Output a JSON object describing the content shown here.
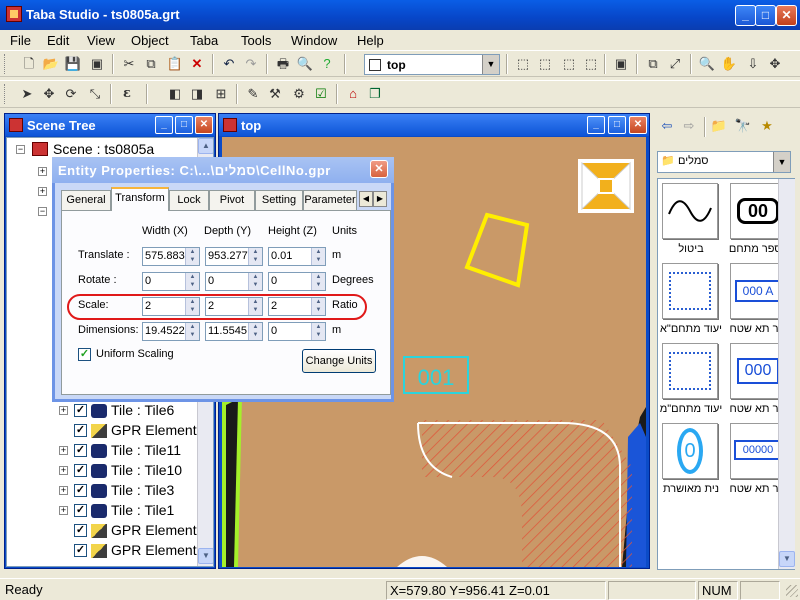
{
  "window": {
    "title": "Taba Studio - ts0805a.grt"
  },
  "menu": [
    "File",
    "Edit",
    "View",
    "Object",
    "Taba",
    "Tools",
    "Window",
    "Help"
  ],
  "toolbar": {
    "view_select": "top",
    "taba_button": "ε"
  },
  "scene_tree": {
    "title": "Scene Tree",
    "root": "Scene : ts0805a",
    "items": [
      {
        "label": "Tile : Tile6",
        "type": "tile"
      },
      {
        "label": "GPR Element",
        "type": "gpr"
      },
      {
        "label": "Tile : Tile11",
        "type": "tile"
      },
      {
        "label": "Tile : Tile10",
        "type": "tile"
      },
      {
        "label": "Tile : Tile3",
        "type": "tile"
      },
      {
        "label": "Tile : Tile1",
        "type": "tile"
      },
      {
        "label": "GPR Element",
        "type": "gpr"
      },
      {
        "label": "GPR Element",
        "type": "gpr"
      }
    ]
  },
  "view_window": {
    "title": "top",
    "cell_label": "001"
  },
  "dialog": {
    "title": "Entity Properties: C:\\...\\סמלים\\CellNo.gpr",
    "tabs": [
      "General",
      "Transform",
      "Lock",
      "Pivot",
      "Setting",
      "Parameter"
    ],
    "active_tab": "Transform",
    "headers": {
      "width": "Width (X)",
      "depth": "Depth (Y)",
      "height": "Height (Z)",
      "units": "Units"
    },
    "rows": [
      {
        "label": "Translate :",
        "x": "575.883",
        "y": "953.277",
        "z": "0.01",
        "unit": "m"
      },
      {
        "label": "Rotate :",
        "x": "0",
        "y": "0",
        "z": "0",
        "unit": "Degrees"
      },
      {
        "label": "Scale:",
        "x": "2",
        "y": "2",
        "z": "2",
        "unit": "Ratio"
      },
      {
        "label": "Dimensions:",
        "x": "19.4522",
        "y": "11.5545",
        "z": "0",
        "unit": "m"
      }
    ],
    "uniform_scaling": {
      "label": "Uniform Scaling",
      "checked": true
    },
    "change_units": "Change Units"
  },
  "library": {
    "folder": "סמלים",
    "items": [
      {
        "label": "ביטול",
        "glyph": "~"
      },
      {
        "label": "מספר מתחם",
        "glyph": "00"
      },
      {
        "label": "יעוד מתחם\"א",
        "glyph": ""
      },
      {
        "label": "זפר תא שטח",
        "glyph": "000 A"
      },
      {
        "label": "יעוד מתחם\"מ",
        "glyph": ""
      },
      {
        "label": "זפר תא שטח",
        "glyph": "000"
      },
      {
        "label": "נית מאושרת",
        "glyph": "0"
      },
      {
        "label": "זפר תא שטח",
        "glyph": "00000"
      }
    ]
  },
  "status": {
    "ready": "Ready",
    "coords": "X=579.80 Y=956.41 Z=0.01",
    "num": "NUM"
  },
  "colors": {
    "terrain": "#c99968",
    "accent": "#e01919",
    "cyan": "#2ad4dc",
    "yellow": "#ffee00"
  }
}
